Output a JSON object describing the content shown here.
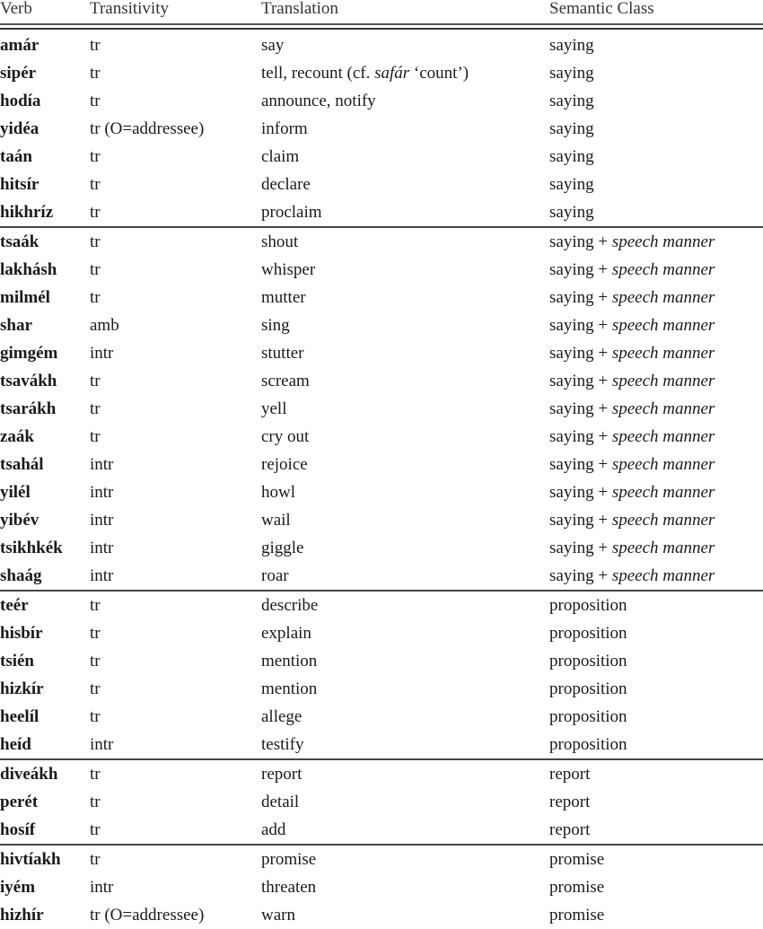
{
  "table": {
    "headers": {
      "verb": "Verb",
      "transitivity": "Transitivity",
      "translation": "Translation",
      "semantic_class": "Semantic Class"
    },
    "groups": [
      {
        "rows": [
          {
            "verb": "amár",
            "transitivity": "tr",
            "translation": "say",
            "semantic_class": "saying"
          },
          {
            "verb": "sipér",
            "transitivity": "tr",
            "translation_pre": "tell, recount (cf. ",
            "translation_italic": "safár",
            "translation_post": " ‘count’)",
            "semantic_class": "saying"
          },
          {
            "verb": "hodía",
            "transitivity": "tr",
            "translation": "announce, notify",
            "semantic_class": "saying"
          },
          {
            "verb": "yidéa",
            "transitivity": "tr (O=addressee)",
            "translation": "inform",
            "semantic_class": "saying"
          },
          {
            "verb": "taán",
            "transitivity": "tr",
            "translation": "claim",
            "semantic_class": "saying"
          },
          {
            "verb": "hitsír",
            "transitivity": "tr",
            "translation": "declare",
            "semantic_class": "saying"
          },
          {
            "verb": "hikhríz",
            "transitivity": "tr",
            "translation": "proclaim",
            "semantic_class": "saying"
          }
        ]
      },
      {
        "rows": [
          {
            "verb": "tsaák",
            "transitivity": "tr",
            "translation": "shout",
            "semantic_class": "saying + ",
            "semantic_class_italic": "speech manner"
          },
          {
            "verb": "lakhásh",
            "transitivity": "tr",
            "translation": "whisper",
            "semantic_class": "saying + ",
            "semantic_class_italic": "speech manner"
          },
          {
            "verb": "milmél",
            "transitivity": "tr",
            "translation": "mutter",
            "semantic_class": "saying + ",
            "semantic_class_italic": "speech manner"
          },
          {
            "verb": "shar",
            "transitivity": "amb",
            "translation": "sing",
            "semantic_class": "saying + ",
            "semantic_class_italic": "speech manner"
          },
          {
            "verb": "gimgém",
            "transitivity": "intr",
            "translation": "stutter",
            "semantic_class": "saying + ",
            "semantic_class_italic": "speech manner"
          },
          {
            "verb": "tsavákh",
            "transitivity": "tr",
            "translation": "scream",
            "semantic_class": "saying + ",
            "semantic_class_italic": "speech manner"
          },
          {
            "verb": "tsarákh",
            "transitivity": "tr",
            "translation": "yell",
            "semantic_class": "saying + ",
            "semantic_class_italic": "speech manner"
          },
          {
            "verb": "zaák",
            "transitivity": "tr",
            "translation": "cry out",
            "semantic_class": "saying + ",
            "semantic_class_italic": "speech manner"
          },
          {
            "verb": "tsahál",
            "transitivity": "intr",
            "translation": "rejoice",
            "semantic_class": "saying + ",
            "semantic_class_italic": "speech manner"
          },
          {
            "verb": "yilél",
            "transitivity": "intr",
            "translation": "howl",
            "semantic_class": "saying + ",
            "semantic_class_italic": "speech manner"
          },
          {
            "verb": "yibév",
            "transitivity": "intr",
            "translation": "wail",
            "semantic_class": "saying + ",
            "semantic_class_italic": "speech manner"
          },
          {
            "verb": "tsikhkék",
            "transitivity": "intr",
            "translation": "giggle",
            "semantic_class": "saying + ",
            "semantic_class_italic": "speech manner"
          },
          {
            "verb": "shaág",
            "transitivity": "intr",
            "translation": "roar",
            "semantic_class": "saying + ",
            "semantic_class_italic": "speech manner"
          }
        ]
      },
      {
        "rows": [
          {
            "verb": "teér",
            "transitivity": "tr",
            "translation": "describe",
            "semantic_class": "proposition"
          },
          {
            "verb": "hisbír",
            "transitivity": "tr",
            "translation": "explain",
            "semantic_class": "proposition"
          },
          {
            "verb": "tsién",
            "transitivity": "tr",
            "translation": "mention",
            "semantic_class": "proposition"
          },
          {
            "verb": "hizkír",
            "transitivity": "tr",
            "translation": "mention",
            "semantic_class": "proposition"
          },
          {
            "verb": "heelíl",
            "transitivity": "tr",
            "translation": "allege",
            "semantic_class": "proposition"
          },
          {
            "verb": "heíd",
            "transitivity": "intr",
            "translation": "testify",
            "semantic_class": "proposition"
          }
        ]
      },
      {
        "rows": [
          {
            "verb": "diveákh",
            "transitivity": "tr",
            "translation": "report",
            "semantic_class": "report"
          },
          {
            "verb": "perét",
            "transitivity": "tr",
            "translation": "detail",
            "semantic_class": "report"
          },
          {
            "verb": "hosíf",
            "transitivity": "tr",
            "translation": "add",
            "semantic_class": "report"
          }
        ]
      },
      {
        "rows": [
          {
            "verb": "hivtíakh",
            "transitivity": "tr",
            "translation": "promise",
            "semantic_class": "promise"
          },
          {
            "verb": "iyém",
            "transitivity": "intr",
            "translation": "threaten",
            "semantic_class": "promise"
          },
          {
            "verb": "hizhír",
            "transitivity": "tr (O=addressee)",
            "translation": "warn",
            "semantic_class": "promise"
          }
        ]
      }
    ]
  }
}
